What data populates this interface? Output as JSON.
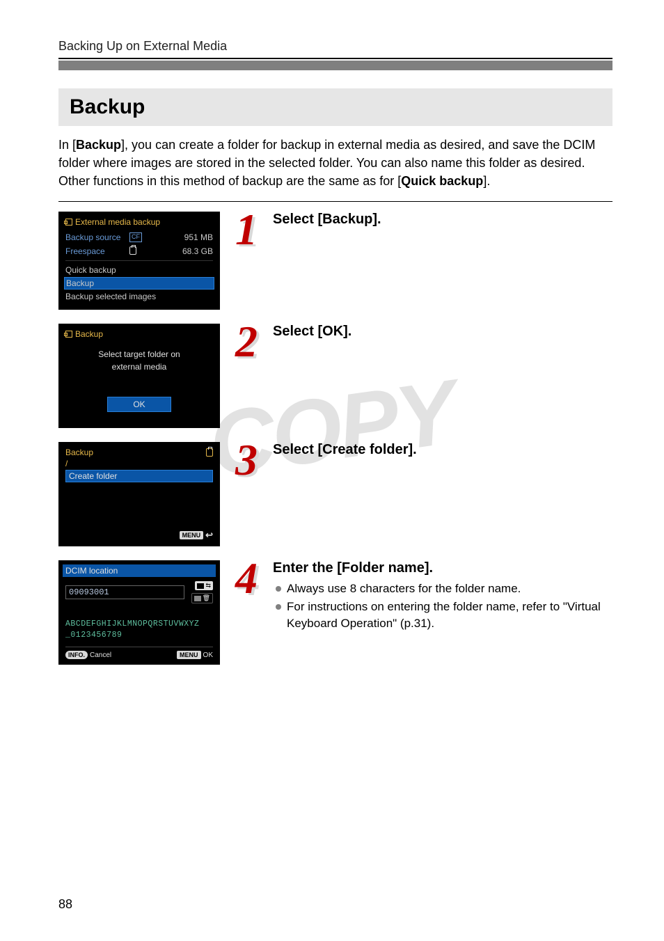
{
  "page": {
    "running_head": "Backing Up on External Media",
    "title": "Backup",
    "page_number": "88",
    "watermark": "COPY"
  },
  "intro": {
    "prefix": "In [",
    "bold1": "Backup",
    "mid": "], you can create a folder for backup in external media as desired, and save the DCIM folder where images are stored in the selected folder. You can also name this folder as desired. Other functions in this method of backup are the same as for [",
    "bold2": "Quick backup",
    "suffix": "]."
  },
  "steps": [
    {
      "num": "1",
      "heading": "Select [Backup].",
      "bullets": []
    },
    {
      "num": "2",
      "heading": "Select [OK].",
      "bullets": []
    },
    {
      "num": "3",
      "heading": "Select [Create folder].",
      "bullets": []
    },
    {
      "num": "4",
      "heading": "Enter the [Folder name].",
      "bullets": [
        "Always use 8 characters for the folder name.",
        "For instructions on entering the folder name, refer to \"Virtual Keyboard Operation\" (p.31)."
      ]
    }
  ],
  "shot1": {
    "title": "External media backup",
    "row1_label": "Backup source",
    "row1_value": "951 MB",
    "row2_label": "Freespace",
    "row2_value": "68.3 GB",
    "items": [
      "Quick backup",
      "Backup",
      "Backup selected images"
    ]
  },
  "shot2": {
    "title": "Backup",
    "msg_line1": "Select target folder on",
    "msg_line2": "external media",
    "ok": "OK"
  },
  "shot3": {
    "title": "Backup",
    "slash": "/",
    "item": "Create folder",
    "menu_label": "MENU"
  },
  "shot4": {
    "header": "DCIM location",
    "input_value": "09093001",
    "kb_row1": "ABCDEFGHIJKLMNOPQRSTUVWXYZ",
    "kb_row2": "_0123456789",
    "info_label": "INFO.",
    "cancel": "Cancel",
    "menu_label": "MENU",
    "ok": "OK"
  }
}
